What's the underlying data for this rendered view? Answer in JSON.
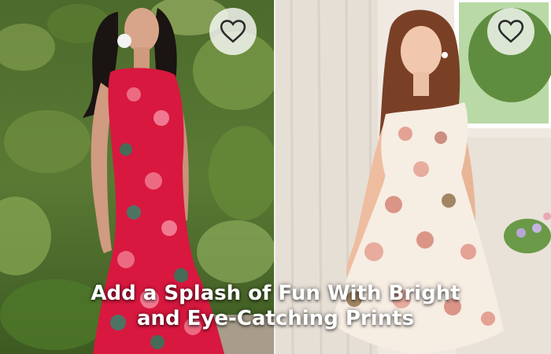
{
  "banner": {
    "caption_line1": "Add a Splash of Fun With Bright",
    "caption_line2": "and Eye-Catching Prints"
  },
  "products": [
    {
      "image": "model-red-floral-maxi-dress",
      "favorite_icon": "heart-outline-icon",
      "dress_color": "#d8183f"
    },
    {
      "image": "model-white-floral-mini-dress",
      "favorite_icon": "heart-outline-icon",
      "dress_color": "#f6ede3"
    }
  ],
  "colors": {
    "caption_text": "#ffffff",
    "favorite_button_bg": "#ffffff"
  }
}
